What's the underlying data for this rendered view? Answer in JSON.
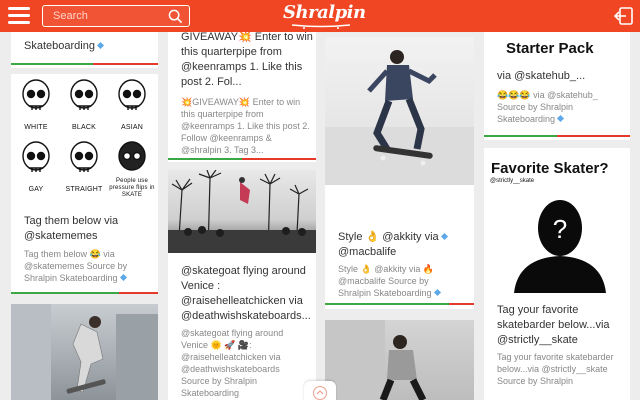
{
  "app": {
    "logo_text": "Shralpin"
  },
  "header": {
    "search_placeholder": "Search"
  },
  "col1": {
    "card1": {
      "text": "Skateboarding"
    },
    "card2": {
      "memes": [
        "WHITE",
        "BLACK",
        "ASIAN",
        "GAY",
        "STRAIGHT",
        "People use pressure flips in SKATE"
      ],
      "title_line1": "Tag them below via",
      "title_line2": "@skatememes",
      "sub_line1": "Tag them below 😂 via",
      "sub_line2": "@skatememes Source by",
      "sub_line3": "Shralpin Skateboarding"
    }
  },
  "col2": {
    "card1": {
      "line1": "GIVEAWAY💥 Enter to win",
      "line2": "this quarterpipe from",
      "line3": "@keenramps 1. Like this",
      "line4": "post 2. Fol...",
      "sub1": "💥GIVEAWAY💥 Enter to win",
      "sub2": "this quarterpipe from",
      "sub3": "@keenramps 1. Like this post 2.",
      "sub4": "Follow @keenramps &",
      "sub5": "@shralpin 3. Tag 3..."
    },
    "card2": {
      "line1": "@skategoat flying around",
      "line2": "Venice :",
      "line3": "@raisehelleatchicken via",
      "line4": "@deathwishskateboards...",
      "sub1": "@skategoat flying around",
      "sub2": "Venice 🌞 🚀 🎥:",
      "sub3": "@raisehelleatchicken via",
      "sub4": "@deathwishskateboards",
      "sub5": "Source by Shralpin",
      "sub6": "Skateboarding"
    }
  },
  "col3": {
    "card1": {
      "line1": "Style 👌 @akkity via",
      "line2": "@macbalife",
      "sub1": "Style 👌 @akkity via 🔥",
      "sub2": "@macbalife Source by",
      "sub3": "Shralpin Skateboarding"
    }
  },
  "col4": {
    "card1": {
      "banner": "Starter Pack",
      "line1": "via @skatehub_...",
      "sub1": "😂😂😂 via @skatehub_",
      "sub2": "Source by Shralpin",
      "sub3": "Skateboarding"
    },
    "card2": {
      "banner_title": "Favorite Skater?",
      "banner_handle": "@strictly__skate",
      "line1": "Tag your favorite",
      "line2": "skatebarder below...via",
      "line3": "@strictly__skate",
      "sub1": "Tag your favorite skatebarder",
      "sub2": "below...via @strictly__skate",
      "sub3": "Source by Shralpin"
    }
  },
  "colors": {
    "brand": "#f04623",
    "upvote": "#3ca845",
    "downvote": "#e53a2b",
    "verified": "#5fa8e8"
  }
}
